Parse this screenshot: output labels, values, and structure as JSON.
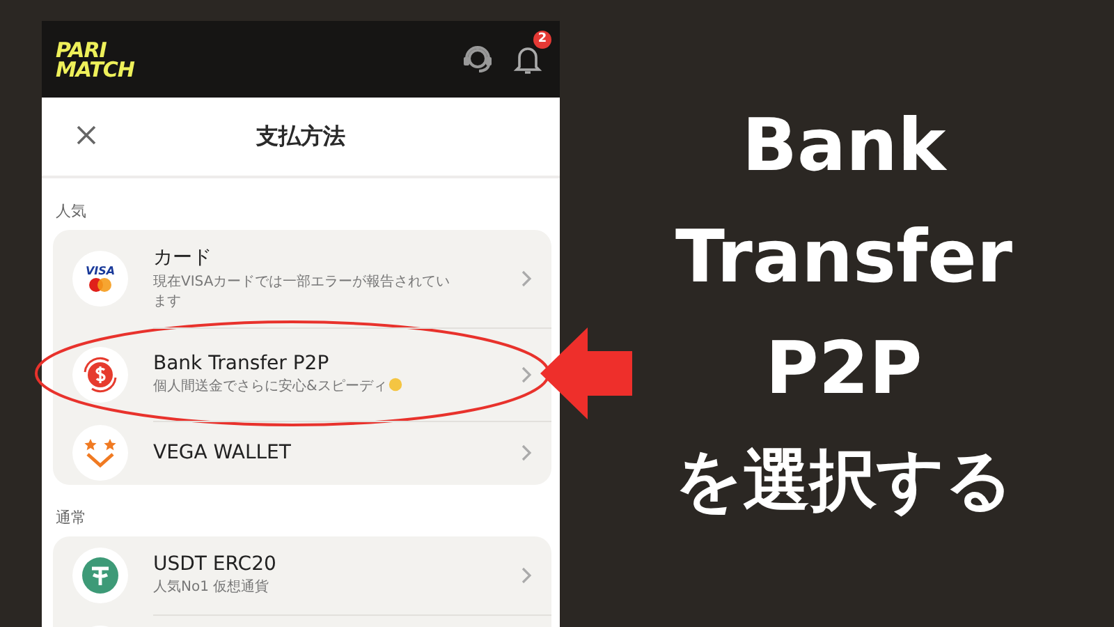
{
  "header": {
    "logo": [
      "PARI",
      "MATCH"
    ],
    "notification_count": "2"
  },
  "dialog": {
    "title": "支払方法"
  },
  "sections": [
    {
      "label": "人気",
      "methods": [
        {
          "kind": "visa",
          "logo_text": "VISA",
          "name": "カード",
          "description": "現在VISAカードでは一部エラーが報告されています",
          "highlighted": false
        },
        {
          "kind": "p2p",
          "name": "Bank Transfer P2P",
          "description": "個人間送金でさらに安心&スピーディ",
          "highlighted": true
        },
        {
          "kind": "vega",
          "name": "VEGA WALLET",
          "highlighted": false
        }
      ]
    },
    {
      "label": "通常",
      "methods": [
        {
          "kind": "usdt",
          "name": "USDT ERC20",
          "description": "人気No1 仮想通貨",
          "highlighted": false
        },
        {
          "kind": "more",
          "highlighted": false
        }
      ]
    }
  ],
  "caption": {
    "lines": [
      "Bank",
      "Transfer",
      "P2P",
      "を選択する"
    ]
  }
}
